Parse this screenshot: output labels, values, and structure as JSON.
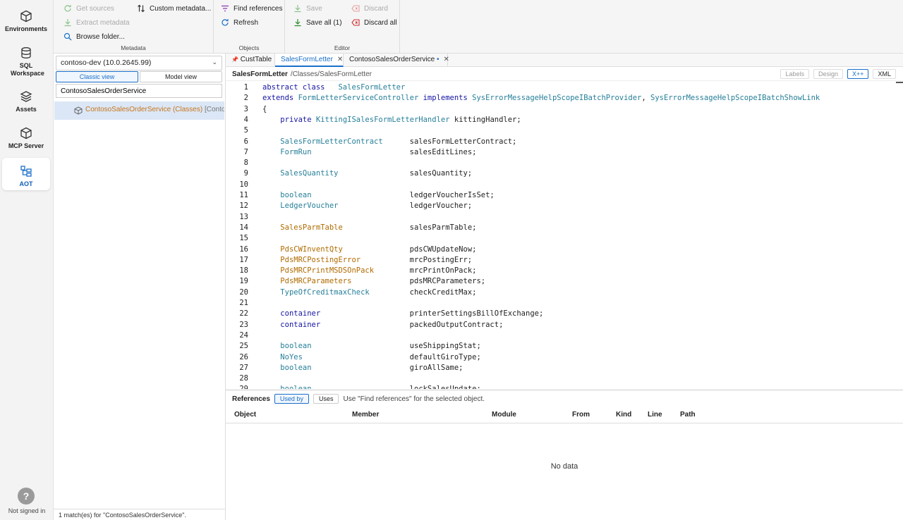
{
  "rail": {
    "items": [
      {
        "label": "Environments",
        "icon": "cube-icon"
      },
      {
        "label": "SQL Workspace",
        "icon": "database-icon"
      },
      {
        "label": "Assets",
        "icon": "layers-icon"
      },
      {
        "label": "MCP Server",
        "icon": "cube-icon"
      },
      {
        "label": "AOT",
        "icon": "tree-icon",
        "active": true
      }
    ],
    "help": "?",
    "user_status": "Not signed in"
  },
  "toolbar": {
    "metadata": {
      "caption": "Metadata",
      "get_sources": "Get sources",
      "extract_metadata": "Extract metadata",
      "browse_folder": "Browse folder...",
      "custom_metadata": "Custom metadata..."
    },
    "objects": {
      "caption": "Objects",
      "find_references": "Find references",
      "refresh": "Refresh"
    },
    "editor": {
      "caption": "Editor",
      "save": "Save",
      "save_all": "Save all (1)",
      "discard": "Discard",
      "discard_all": "Discard all"
    }
  },
  "sidebar": {
    "environment": "contoso-dev (10.0.2645.99)",
    "view_tabs": {
      "classic": "Classic view",
      "model": "Model view"
    },
    "search_value": "ContosoSalesOrderService",
    "tree_item": {
      "label": "ContosoSalesOrderService (Classes)",
      "module": "[Contoso"
    },
    "match_status": "1 match(es) for \"ContosoSalesOrderService\"."
  },
  "editor": {
    "tabs": [
      {
        "label": "CustTable",
        "pinned": true
      },
      {
        "label": "SalesFormLetter",
        "active": true,
        "close": "✕"
      },
      {
        "label": "ContosoSalesOrderService",
        "modified": "•",
        "close": "✕"
      }
    ],
    "path": {
      "name": "SalesFormLetter",
      "location": "/Classes/SalesFormLetter"
    },
    "modes": {
      "labels": "Labels",
      "design": "Design",
      "xpp": "X++",
      "xml": "XML"
    },
    "code_lines": [
      {
        "n": "1",
        "segs": [
          [
            "kw",
            "abstract class"
          ],
          [
            "",
            "   "
          ],
          [
            "ty",
            "SalesFormLetter"
          ]
        ]
      },
      {
        "n": "2",
        "segs": [
          [
            "kw",
            "extends"
          ],
          [
            "",
            " "
          ],
          [
            "ty",
            "FormLetterServiceController"
          ],
          [
            "",
            " "
          ],
          [
            "kw",
            "implements"
          ],
          [
            "",
            " "
          ],
          [
            "ty",
            "SysErrorMessageHelpScopeIBatchProvider"
          ],
          [
            "",
            ", "
          ],
          [
            "ty",
            "SysErrorMessageHelpScopeIBatchShowLink"
          ]
        ]
      },
      {
        "n": "3",
        "segs": [
          [
            "",
            "{"
          ]
        ]
      },
      {
        "n": "4",
        "segs": [
          [
            "",
            "    "
          ],
          [
            "kw",
            "private"
          ],
          [
            "",
            " "
          ],
          [
            "ty",
            "KittingISalesFormLetterHandler"
          ],
          [
            "",
            " kittingHandler;"
          ]
        ]
      },
      {
        "n": "5",
        "segs": []
      },
      {
        "n": "6",
        "segs": [
          [
            "",
            "    "
          ],
          [
            "ty",
            "SalesFormLetterContract"
          ],
          [
            "",
            "      salesFormLetterContract;"
          ]
        ]
      },
      {
        "n": "7",
        "segs": [
          [
            "",
            "    "
          ],
          [
            "ty",
            "FormRun"
          ],
          [
            "",
            "                      salesEditLines;"
          ]
        ]
      },
      {
        "n": "8",
        "segs": []
      },
      {
        "n": "9",
        "segs": [
          [
            "",
            "    "
          ],
          [
            "ty",
            "SalesQuantity"
          ],
          [
            "",
            "                salesQuantity;"
          ]
        ]
      },
      {
        "n": "10",
        "segs": []
      },
      {
        "n": "11",
        "segs": [
          [
            "",
            "    "
          ],
          [
            "ty",
            "boolean"
          ],
          [
            "",
            "                      ledgerVoucherIsSet;"
          ]
        ]
      },
      {
        "n": "12",
        "segs": [
          [
            "",
            "    "
          ],
          [
            "ty",
            "LedgerVoucher"
          ],
          [
            "",
            "                ledgerVoucher;"
          ]
        ]
      },
      {
        "n": "13",
        "segs": []
      },
      {
        "n": "14",
        "segs": [
          [
            "",
            "    "
          ],
          [
            "tyo",
            "SalesParmTable"
          ],
          [
            "",
            "               salesParmTable;"
          ]
        ]
      },
      {
        "n": "15",
        "segs": []
      },
      {
        "n": "16",
        "segs": [
          [
            "",
            "    "
          ],
          [
            "tyo",
            "PdsCWInventQty"
          ],
          [
            "",
            "               pdsCWUpdateNow;"
          ]
        ]
      },
      {
        "n": "17",
        "segs": [
          [
            "",
            "    "
          ],
          [
            "tyo",
            "PdsMRCPostingError"
          ],
          [
            "",
            "           mrcPostingErr;"
          ]
        ]
      },
      {
        "n": "18",
        "segs": [
          [
            "",
            "    "
          ],
          [
            "tyo",
            "PdsMRCPrintMSDSOnPack"
          ],
          [
            "",
            "        mrcPrintOnPack;"
          ]
        ]
      },
      {
        "n": "19",
        "segs": [
          [
            "",
            "    "
          ],
          [
            "tyo",
            "PdsMRCParameters"
          ],
          [
            "",
            "             pdsMRCParameters;"
          ]
        ]
      },
      {
        "n": "20",
        "segs": [
          [
            "",
            "    "
          ],
          [
            "ty",
            "TypeOfCreditmaxCheck"
          ],
          [
            "",
            "         checkCreditMax;"
          ]
        ]
      },
      {
        "n": "21",
        "segs": []
      },
      {
        "n": "22",
        "segs": [
          [
            "",
            "    "
          ],
          [
            "kw",
            "container"
          ],
          [
            "",
            "                    printerSettingsBillOfExchange;"
          ]
        ]
      },
      {
        "n": "23",
        "segs": [
          [
            "",
            "    "
          ],
          [
            "kw",
            "container"
          ],
          [
            "",
            "                    packedOutputContract;"
          ]
        ]
      },
      {
        "n": "24",
        "segs": []
      },
      {
        "n": "25",
        "segs": [
          [
            "",
            "    "
          ],
          [
            "ty",
            "boolean"
          ],
          [
            "",
            "                      useShippingStat;"
          ]
        ]
      },
      {
        "n": "26",
        "segs": [
          [
            "",
            "    "
          ],
          [
            "ty",
            "NoYes"
          ],
          [
            "",
            "                        defaultGiroType;"
          ]
        ]
      },
      {
        "n": "27",
        "segs": [
          [
            "",
            "    "
          ],
          [
            "ty",
            "boolean"
          ],
          [
            "",
            "                      giroAllSame;"
          ]
        ]
      },
      {
        "n": "28",
        "segs": []
      },
      {
        "n": "29",
        "segs": [
          [
            "",
            "    "
          ],
          [
            "ty",
            "boolean"
          ],
          [
            "",
            "                      lockSalesUpdate;"
          ]
        ]
      }
    ]
  },
  "references": {
    "title": "References",
    "used_by": "Used by",
    "uses": "Uses",
    "hint": "Use \"Find references\" for the selected object.",
    "columns": [
      "Object",
      "Member",
      "Module",
      "From",
      "Kind",
      "Line",
      "Path"
    ],
    "empty": "No data"
  }
}
